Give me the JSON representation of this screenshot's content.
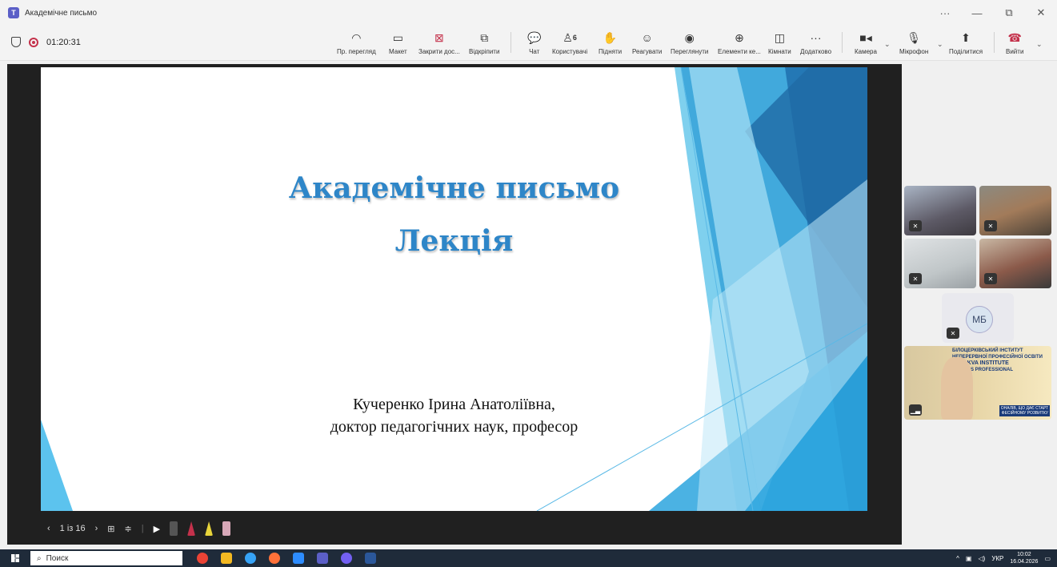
{
  "window": {
    "title": "Академічне письмо",
    "more": "···",
    "minimize": "—",
    "restore": "⧉",
    "close": "✕"
  },
  "meeting": {
    "timer": "01:20:31"
  },
  "toolbar": {
    "preview": "Пр. перегляд",
    "layout": "Макет",
    "close_share": "Закрити дос...",
    "unpin": "Відкріпити",
    "chat": "Чат",
    "people": "Користувачі",
    "people_count": "6",
    "raise": "Підняти",
    "react": "Реагувати",
    "view": "Переглянути",
    "apps": "Елементи ке...",
    "rooms": "Кімнати",
    "more": "Додатково",
    "camera": "Камера",
    "mic": "Мікрофон",
    "share": "Поділитися",
    "leave": "Вийти"
  },
  "slide": {
    "title_line1": "Академічне письмо",
    "title_line2": "Лекція",
    "author": "Кучеренко Ірина Анатоліївна,",
    "degree": "доктор педагогічних наук, професор"
  },
  "slide_controls": {
    "counter": "1 із 16"
  },
  "participants": {
    "initials": "МБ",
    "banner_line1": "БІЛОЦЕРКІВСЬКИЙ ІНСТИТУТ",
    "banner_line2": "НЕПЕРЕРВНОЇ ПРОФЕСІЙНОЇ ОСВІТИ",
    "banner_line3": "TSERKVA INSTITUTE",
    "banner_line4": "TINUOUS PROFESSIONAL",
    "banner_line5": "TION",
    "banner_line6": "ОНАЛІВ, ЩО ДАЄ СТАРТ",
    "banner_line7": "ФЕСІЙНОМУ РОЗВИТКУ"
  },
  "taskbar": {
    "search": "Поиск",
    "lang": "УКР",
    "time": "10:02",
    "date": "16.04.2026"
  }
}
